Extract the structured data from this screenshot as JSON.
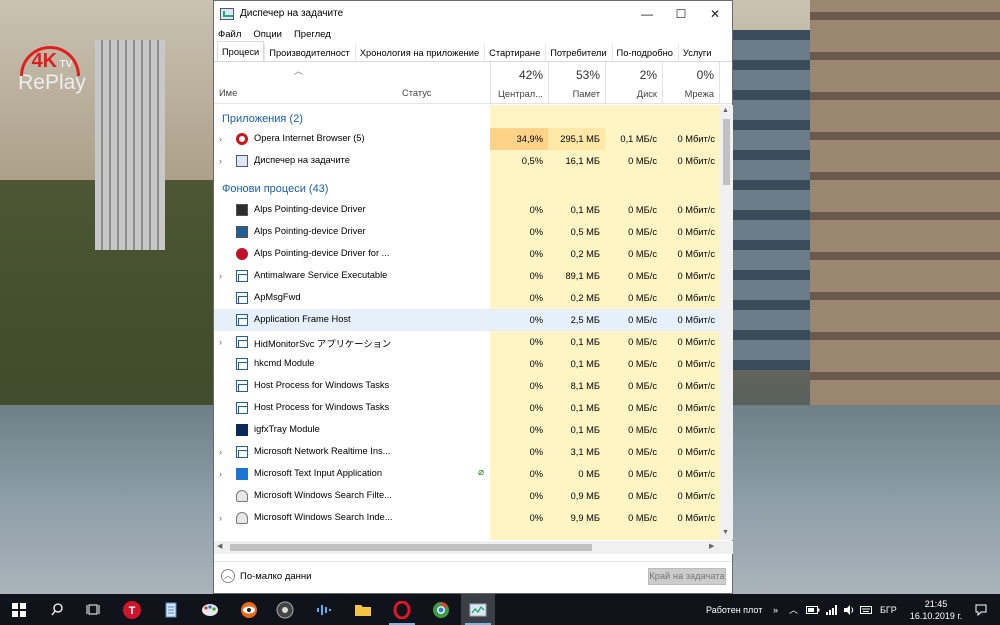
{
  "window": {
    "title": "Диспечер на задачите",
    "controls": {
      "minimize": "—",
      "maximize": "☐",
      "close": "✕"
    }
  },
  "menu": [
    "Файл",
    "Опции",
    "Преглед"
  ],
  "tabs": [
    "Процеси",
    "Производителност",
    "Хронология на приложение",
    "Стартиране",
    "Потребители",
    "По-подробно",
    "Услуги"
  ],
  "header": {
    "name": "Име",
    "status": "Статус",
    "columns": [
      {
        "pct": "42%",
        "label": "Централ..."
      },
      {
        "pct": "53%",
        "label": "Памет"
      },
      {
        "pct": "2%",
        "label": "Диск"
      },
      {
        "pct": "0%",
        "label": "Мрежа"
      }
    ]
  },
  "groups": {
    "apps": "Приложения (2)",
    "background": "Фонови процеси (43)"
  },
  "apps": [
    {
      "name": "Opera Internet Browser (5)",
      "cpu": "34,9%",
      "mem": "295,1 МБ",
      "disk": "0,1 МБ/с",
      "net": "0 Мбит/с",
      "icon": "opera-icon"
    },
    {
      "name": "Диспечер на задачите",
      "cpu": "0,5%",
      "mem": "16,1 МБ",
      "disk": "0 МБ/с",
      "net": "0 Мбит/с",
      "icon": "task-manager-icon"
    }
  ],
  "background": [
    {
      "name": "Alps Pointing-device Driver",
      "cpu": "0%",
      "mem": "0,1 МБ",
      "disk": "0 МБ/с",
      "net": "0 Мбит/с",
      "icon": "alps-icon",
      "expand": false
    },
    {
      "name": "Alps Pointing-device Driver",
      "cpu": "0%",
      "mem": "0,5 МБ",
      "disk": "0 МБ/с",
      "net": "0 Мбит/с",
      "icon": "alps-monitor-icon",
      "expand": false
    },
    {
      "name": "Alps Pointing-device Driver for ...",
      "cpu": "0%",
      "mem": "0,2 МБ",
      "disk": "0 МБ/с",
      "net": "0 Мбит/с",
      "icon": "raspberry-icon",
      "expand": false
    },
    {
      "name": "Antimalware Service Executable",
      "cpu": "0%",
      "mem": "89,1 МБ",
      "disk": "0 МБ/с",
      "net": "0 Мбит/с",
      "icon": "window-icon",
      "expand": true
    },
    {
      "name": "ApMsgFwd",
      "cpu": "0%",
      "mem": "0,2 МБ",
      "disk": "0 МБ/с",
      "net": "0 Мбит/с",
      "icon": "window-icon",
      "expand": false
    },
    {
      "name": "Application Frame Host",
      "cpu": "0%",
      "mem": "2,5 МБ",
      "disk": "0 МБ/с",
      "net": "0 Мбит/с",
      "icon": "window-icon",
      "expand": false
    },
    {
      "name": "HidMonitorSvc アプリケーション",
      "cpu": "0%",
      "mem": "0,1 МБ",
      "disk": "0 МБ/с",
      "net": "0 Мбит/с",
      "icon": "window-icon",
      "expand": true
    },
    {
      "name": "hkcmd Module",
      "cpu": "0%",
      "mem": "0,1 МБ",
      "disk": "0 МБ/с",
      "net": "0 Мбит/с",
      "icon": "window-icon",
      "expand": false
    },
    {
      "name": "Host Process for Windows Tasks",
      "cpu": "0%",
      "mem": "8,1 МБ",
      "disk": "0 МБ/с",
      "net": "0 Мбит/с",
      "icon": "window-icon",
      "expand": false
    },
    {
      "name": "Host Process for Windows Tasks",
      "cpu": "0%",
      "mem": "0,1 МБ",
      "disk": "0 МБ/с",
      "net": "0 Мбит/с",
      "icon": "window-icon",
      "expand": false
    },
    {
      "name": "igfxTray Module",
      "cpu": "0%",
      "mem": "0,1 МБ",
      "disk": "0 МБ/с",
      "net": "0 Мбит/с",
      "icon": "intel-graphics-icon",
      "expand": false
    },
    {
      "name": "Microsoft Network Realtime Ins...",
      "cpu": "0%",
      "mem": "3,1 МБ",
      "disk": "0 МБ/с",
      "net": "0 Мбит/с",
      "icon": "window-icon",
      "expand": true
    },
    {
      "name": "Microsoft Text Input Application",
      "cpu": "0%",
      "mem": "0 МБ",
      "disk": "0 МБ/с",
      "net": "0 Мбит/с",
      "icon": "text-input-icon",
      "expand": true,
      "status_leaf": true
    },
    {
      "name": "Microsoft Windows Search Filte...",
      "cpu": "0%",
      "mem": "0,9 МБ",
      "disk": "0 МБ/с",
      "net": "0 Мбит/с",
      "icon": "user-icon",
      "expand": false
    },
    {
      "name": "Microsoft Windows Search Inde...",
      "cpu": "0%",
      "mem": "9,9 МБ",
      "disk": "0 МБ/с",
      "net": "0 Мбит/с",
      "icon": "user-icon",
      "expand": true
    }
  ],
  "footer": {
    "fewer": "По-малко данни",
    "end_task": "Край на задачата"
  },
  "desktop_logo": {
    "k4": "4K",
    "tv": "TV",
    "replay": "RePlay"
  },
  "taskbar": {
    "desktop_label": "Работен плот",
    "lang": "БГР",
    "time": "21:45",
    "date": "16.10.2019 г."
  },
  "colors": {
    "accent": "#1b5eab",
    "cpu_heat_high": "#ffd28a",
    "heat_low": "#fff4c4",
    "selection": "#e6f0fa"
  }
}
